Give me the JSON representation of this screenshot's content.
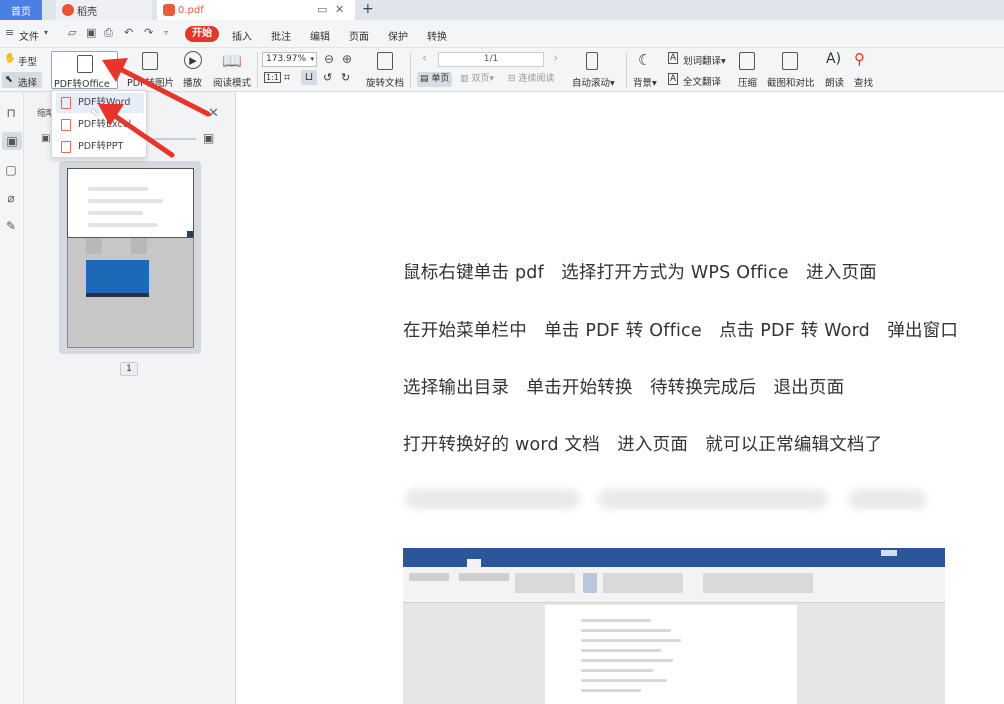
{
  "tabs": {
    "home": "首页",
    "daoke": "稻壳",
    "pdf": "0.pdf",
    "add": "+"
  },
  "menu": {
    "file": "文件",
    "start": "开始",
    "items": [
      "插入",
      "批注",
      "编辑",
      "页面",
      "保护",
      "转换"
    ]
  },
  "ribbon": {
    "hand": "手型",
    "select": "选择",
    "pdf_to_office": "PDF转Office",
    "pdf_to_image": "PDF转图片",
    "play": "播放",
    "read_mode": "阅读模式",
    "zoom": "173.97%",
    "rotate": "旋转文档",
    "page_value": "1/1",
    "single": "单页",
    "double": "双页",
    "continuous": "连续阅读",
    "auto_scroll": "自动滚动",
    "background": "背景",
    "word_translate": "划词翻译",
    "full_translate": "全文翻译",
    "compress": "压缩",
    "screenshot_compare": "截图和对比",
    "read_aloud": "朗读",
    "find": "查找"
  },
  "dropdown": {
    "items": [
      "PDF转Word",
      "PDF转Excel",
      "PDF转PPT"
    ]
  },
  "thumb_panel": {
    "title": "缩略",
    "page_number": "1"
  },
  "document": {
    "lines": [
      "鼠标右键单击 pdf   选择打开方式为 WPS Office   进入页面",
      "在开始菜单栏中   单击 PDF 转 Office   点击 PDF 转 Word   弹出窗口",
      "选择输出目录   单击开始转换   待转换完成后   退出页面",
      "打开转换好的 word 文档   进入页面   就可以正常编辑文档了"
    ]
  },
  "colors": {
    "accent_red": "#e4382c",
    "home_tab": "#4a7fe3",
    "word_blue": "#2b579a"
  }
}
